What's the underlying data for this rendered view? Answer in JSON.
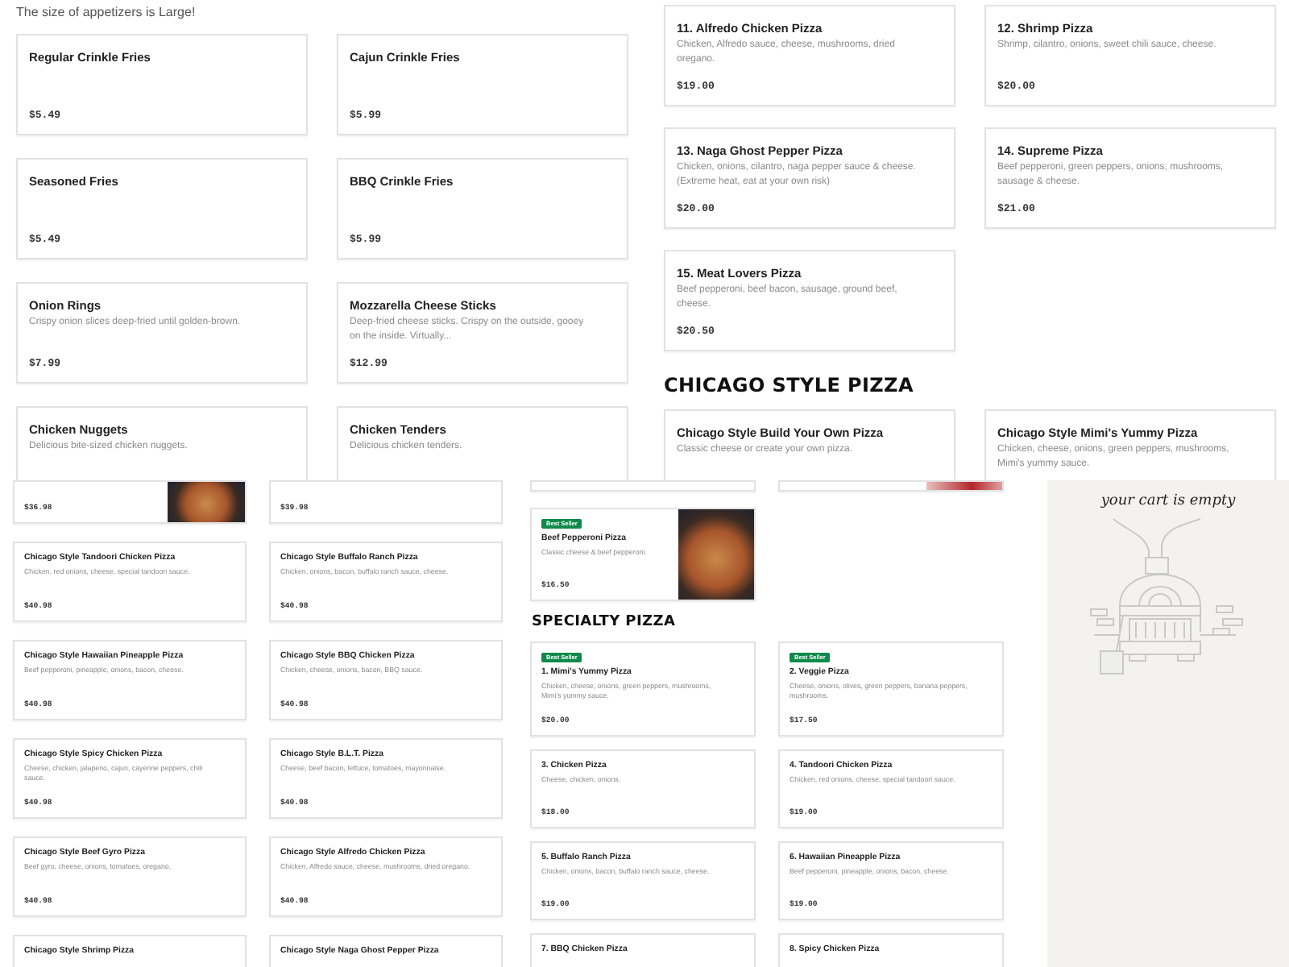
{
  "appetizers": {
    "note": "The size of appetizers is Large!",
    "items": [
      {
        "name": "Regular Crinkle Fries",
        "price": "$5.49"
      },
      {
        "name": "Cajun Crinkle Fries",
        "price": "$5.99"
      },
      {
        "name": "Seasoned Fries",
        "price": "$5.49"
      },
      {
        "name": "BBQ Crinkle Fries",
        "price": "$5.99"
      },
      {
        "name": "Onion Rings",
        "description": "Crispy onion slices deep-fried until golden-brown.",
        "price": "$7.99"
      },
      {
        "name": "Mozzarella Cheese Sticks",
        "description": "Deep-fried cheese sticks. Crispy on the outside, gooey on the inside. Virtually...",
        "price": "$12.99"
      },
      {
        "name": "Chicken Nuggets",
        "description": "Delicious bite-sized chicken nuggets."
      },
      {
        "name": "Chicken Tenders",
        "description": "Delicious chicken tenders."
      }
    ]
  },
  "pizzas": {
    "items": [
      {
        "name": "11. Alfredo Chicken Pizza",
        "description": "Chicken, Alfredo sauce, cheese, mushrooms, dried oregano.",
        "price": "$19.00"
      },
      {
        "name": "12. Shrimp Pizza",
        "description": "Shrimp, cilantro, onions, sweet chili sauce, cheese.",
        "price": "$20.00"
      },
      {
        "name": "13. Naga Ghost Pepper Pizza",
        "description": "Chicken, onions, cilantro, naga pepper sauce & cheese. (Extreme heat, eat at your own risk)",
        "price": "$20.00"
      },
      {
        "name": "14. Supreme Pizza",
        "description": "Beef pepperoni, green peppers, onions, mushrooms, sausage & cheese.",
        "price": "$21.00"
      },
      {
        "name": "15. Meat Lovers Pizza",
        "description": "Beef pepperoni, beef bacon, sausage, ground beef, cheese.",
        "price": "$20.50"
      }
    ],
    "section": {
      "heading": "CHICAGO STYLE PIZZA",
      "items": [
        {
          "name": "Chicago Style Build Your Own Pizza",
          "description": "Classic cheese or create your own pizza."
        },
        {
          "name": "Chicago Style Mimi's Yummy Pizza",
          "description": "Chicken, cheese, onions, green peppers, mushrooms, Mimi's yummy sauce."
        }
      ]
    }
  },
  "chicago": {
    "items": [
      {
        "price": "$36.98",
        "photo": true
      },
      {
        "price": "$39.98",
        "photo": false
      },
      {
        "name": "Chicago Style Tandoori Chicken Pizza",
        "description": "Chicken, red onions, cheese, special tandoori sauce.",
        "price": "$40.98"
      },
      {
        "name": "Chicago Style Buffalo Ranch Pizza",
        "description": "Chicken, onions, bacon, buffalo ranch sauce, cheese.",
        "price": "$40.98"
      },
      {
        "name": "Chicago Style Hawaiian Pineapple Pizza",
        "description": "Beef pepperoni, pineapple, onions, bacon, cheese.",
        "price": "$40.98"
      },
      {
        "name": "Chicago Style BBQ Chicken Pizza",
        "description": "Chicken, cheese, onions, bacon, BBQ sauce.",
        "price": "$40.98"
      },
      {
        "name": "Chicago Style Spicy Chicken Pizza",
        "description": "Cheese, chicken, jalapeno, cajun, cayenne peppers, chili sauce.",
        "price": "$40.98"
      },
      {
        "name": "Chicago Style B.L.T. Pizza",
        "description": "Cheese, beef bacon, lettuce, tomatoes, mayonnaise.",
        "price": "$40.98"
      },
      {
        "name": "Chicago Style Beef Gyro Pizza",
        "description": "Beef gyro, cheese, onions, tomatoes, oregano.",
        "price": "$40.98"
      },
      {
        "name": "Chicago Style Alfredo Chicken Pizza",
        "description": "Chicken, Alfredo sauce, cheese, mushrooms, dried oregano.",
        "price": "$40.98"
      },
      {
        "name": "Chicago Style Shrimp Pizza"
      },
      {
        "name": "Chicago Style Naga Ghost Pepper Pizza"
      }
    ]
  },
  "specialty": {
    "top_items": [
      {
        "photo": false
      },
      {
        "photo": true
      },
      {
        "badge": "Best Seller",
        "name": "Beef Pepperoni Pizza",
        "description": "Classic cheese & beef pepperoni.",
        "price": "$16.50",
        "photo": true
      }
    ],
    "heading": "SPECIALTY PIZZA",
    "items": [
      {
        "badge": "Best Seller",
        "name": "1. Mimi's Yummy Pizza",
        "description": "Chicken, cheese, onions, green peppers, mushrooms, Mimi's yummy sauce.",
        "price": "$20.00"
      },
      {
        "badge": "Best Seller",
        "name": "2. Veggie Pizza",
        "description": "Cheese, onions, olives, green peppers, banana peppers, mushrooms.",
        "price": "$17.50"
      },
      {
        "name": "3. Chicken Pizza",
        "description": "Cheese, chicken, onions.",
        "price": "$18.00"
      },
      {
        "name": "4. Tandoori Chicken Pizza",
        "description": "Chicken, red onions, cheese, special tandoori sauce.",
        "price": "$19.00"
      },
      {
        "name": "5. Buffalo Ranch Pizza",
        "description": "Chicken, onions, bacon, buffalo ranch sauce, cheese.",
        "price": "$19.00"
      },
      {
        "name": "6. Hawaiian Pineapple Pizza",
        "description": "Beef pepperoni, pineapple, onions, bacon, cheese.",
        "price": "$19.00"
      },
      {
        "name": "7. BBQ Chicken Pizza"
      },
      {
        "name": "8. Spicy Chicken Pizza"
      }
    ]
  },
  "cart": {
    "message": "your cart is empty"
  }
}
